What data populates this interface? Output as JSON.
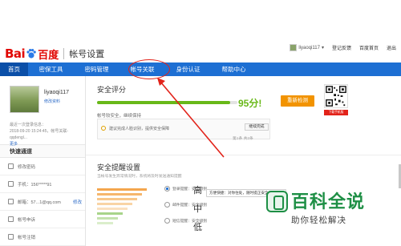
{
  "header": {
    "logo_bai": "Bai",
    "logo_du": "百度",
    "page_title": "帐号设置",
    "username": "liyaoqi117",
    "links": [
      "登记反馈",
      "百度首页",
      "退出"
    ]
  },
  "nav": {
    "items": [
      "首页",
      "密保工具",
      "密码管理",
      "帐号关联",
      "身份认证",
      "帮助中心"
    ],
    "active_index": 0,
    "highlighted_index": 3
  },
  "profile": {
    "username": "liyaoqi117",
    "edit_label": "修改资料",
    "last_login": "最近一次登录信息：",
    "last_login_detail": "2018-09-20 15:24:45，帐号关联-qqdengl...",
    "more_label": "更多"
  },
  "quick": {
    "title": "快速通道",
    "rows": [
      {
        "label": "修改密码",
        "action": ""
      },
      {
        "label": "手机：156*****91",
        "action": ""
      },
      {
        "label": "邮箱：57...1@qq.com",
        "action": "修改"
      },
      {
        "label": "帐号申诉",
        "action": ""
      },
      {
        "label": "帐号注销",
        "action": ""
      }
    ]
  },
  "security": {
    "title": "安全评分",
    "score": 95,
    "score_label": "95分!",
    "detect_button": "重新检测",
    "status": "帐号较安全，继续保持",
    "tip": "建议完成人脸识别，提供安全保障",
    "bind_button": "继续完成",
    "page_indicator": "第1条 共2条",
    "qr_label": "下载手机版"
  },
  "remind": {
    "title": "安全提醒设置",
    "desc": "当帐号发生异常情况时，系统将及时发送通知提醒",
    "options": [
      {
        "label": "登录提醒：安全级别",
        "level": "高",
        "selected": true
      },
      {
        "label": "邮件提醒：安全级别",
        "level": "中",
        "selected": false
      },
      {
        "label": "短信提醒：安全级别",
        "level": "低",
        "selected": false
      }
    ],
    "tooltip": "方便快捷：对你住处，随时提正安全提醒"
  },
  "watermark": {
    "main": "百科全说",
    "sub": "助你轻松解决"
  },
  "colors": {
    "nav_blue": "#1d6fd3",
    "score_green": "#68b818",
    "detect_orange": "#f29300",
    "highlight_red": "#e2231a",
    "watermark_green": "#1e8f45"
  }
}
